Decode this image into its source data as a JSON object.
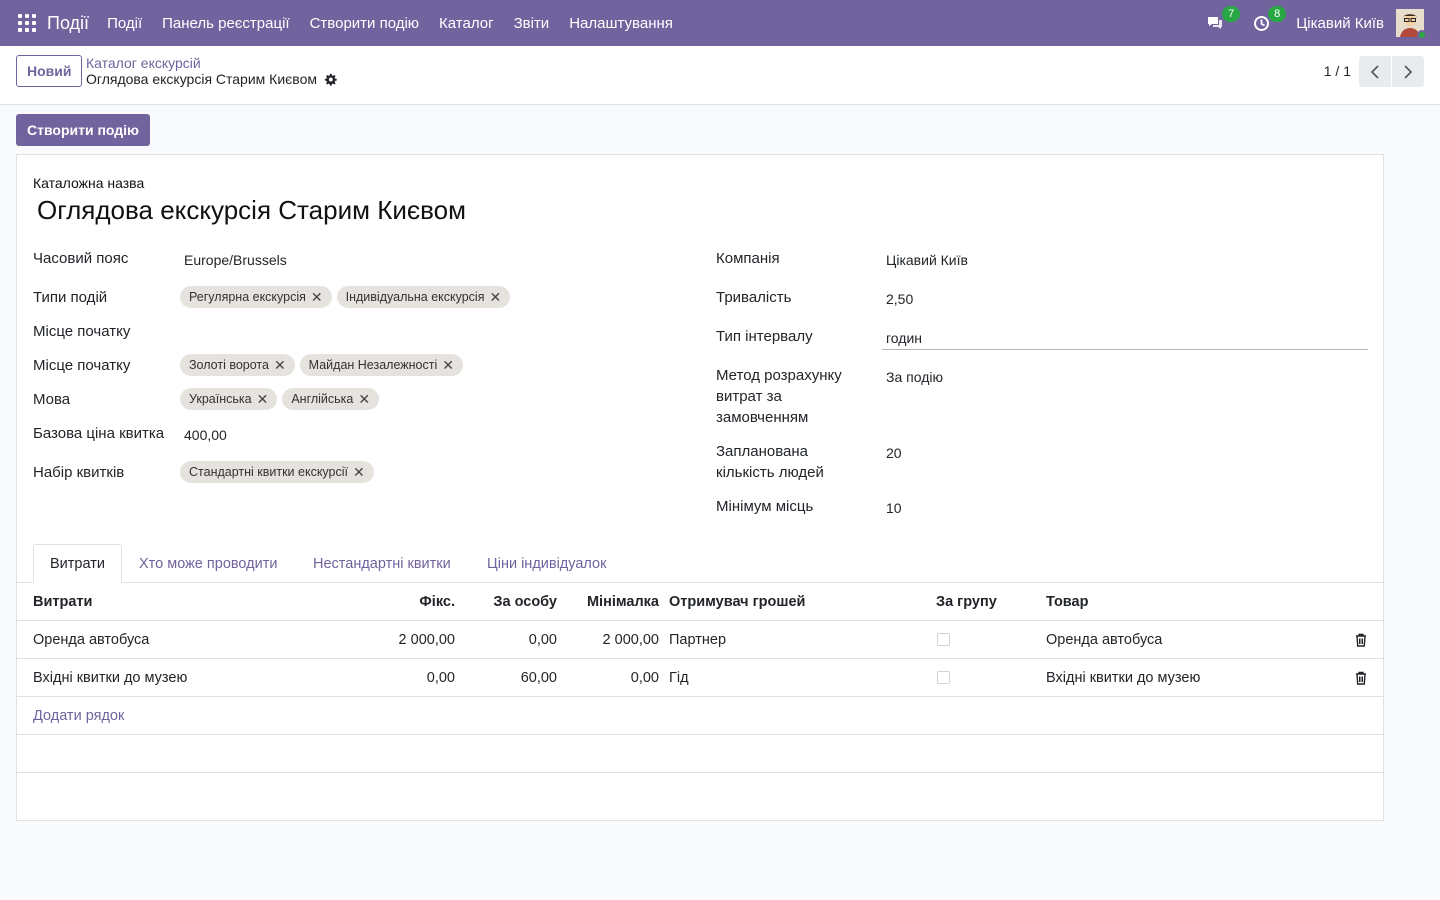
{
  "navbar": {
    "app_name": "Події",
    "menu": [
      "Події",
      "Панель реєстрації",
      "Створити подію",
      "Каталог",
      "Звіти",
      "Налаштування"
    ],
    "messages_count": "7",
    "activities_count": "8",
    "company": "Цікавий Київ",
    "badge_color": "#28a745",
    "brand_color": "#71639e"
  },
  "control_panel": {
    "new_button": "Новий",
    "breadcrumb_parent": "Каталог екскурсій",
    "breadcrumb_current": "Оглядова екскурсія Старим Києвом",
    "pager": "1 / 1"
  },
  "actions": {
    "create_event": "Створити подію"
  },
  "form": {
    "name_label": "Каталожна назва",
    "name_value": "Оглядова екскурсія Старим Києвом",
    "left": {
      "timezone_label": "Часовий пояс",
      "timezone_value": "Europe/Brussels",
      "event_types_label": "Типи подій",
      "event_types": [
        "Регулярна екскурсія",
        "Індивідуальна екскурсія"
      ],
      "start_place_label_1": "Місце початку",
      "start_place_label_2": "Місце початку",
      "start_places": [
        "Золоті ворота",
        "Майдан Незалежності"
      ],
      "language_label": "Мова",
      "languages": [
        "Українська",
        "Англійська"
      ],
      "base_price_label": "Базова ціна квитка",
      "base_price_value": "400,00",
      "ticket_set_label": "Набір квитків",
      "ticket_sets": [
        "Стандартні квитки екскурсії"
      ]
    },
    "right": {
      "company_label": "Компанія",
      "company_value": "Цікавий Київ",
      "duration_label": "Тривалість",
      "duration_value": "2,50",
      "interval_label": "Тип інтервалу",
      "interval_value": "годин",
      "cost_method_label_1": "Метод розрахунку",
      "cost_method_label_2": "витрат за",
      "cost_method_label_3": "замовченням",
      "cost_method_value": "За подію",
      "planned_people_label_1": "Запланована",
      "planned_people_label_2": "кількість людей",
      "planned_people_value": "20",
      "min_seats_label": "Мінімум місць",
      "min_seats_value": "10"
    }
  },
  "tabs": [
    "Витрати",
    "Хто може проводити",
    "Нестандартні квитки",
    "Ціни індивідуалок"
  ],
  "expenses_table": {
    "headers": [
      "Витрати",
      "Фікс.",
      "За особу",
      "Мінімалка",
      "Отримувач грошей",
      "За групу",
      "Товар"
    ],
    "rows": [
      {
        "name": "Оренда автобуса",
        "fixed": "2 000,00",
        "per_person": "0,00",
        "minimum": "2 000,00",
        "payee": "Партнер",
        "per_group": false,
        "product": "Оренда автобуса"
      },
      {
        "name": "Вхідні квитки до музею",
        "fixed": "0,00",
        "per_person": "60,00",
        "minimum": "0,00",
        "payee": "Гід",
        "per_group": false,
        "product": "Вхідні квитки до музею"
      }
    ],
    "add_line": "Додати рядок"
  }
}
